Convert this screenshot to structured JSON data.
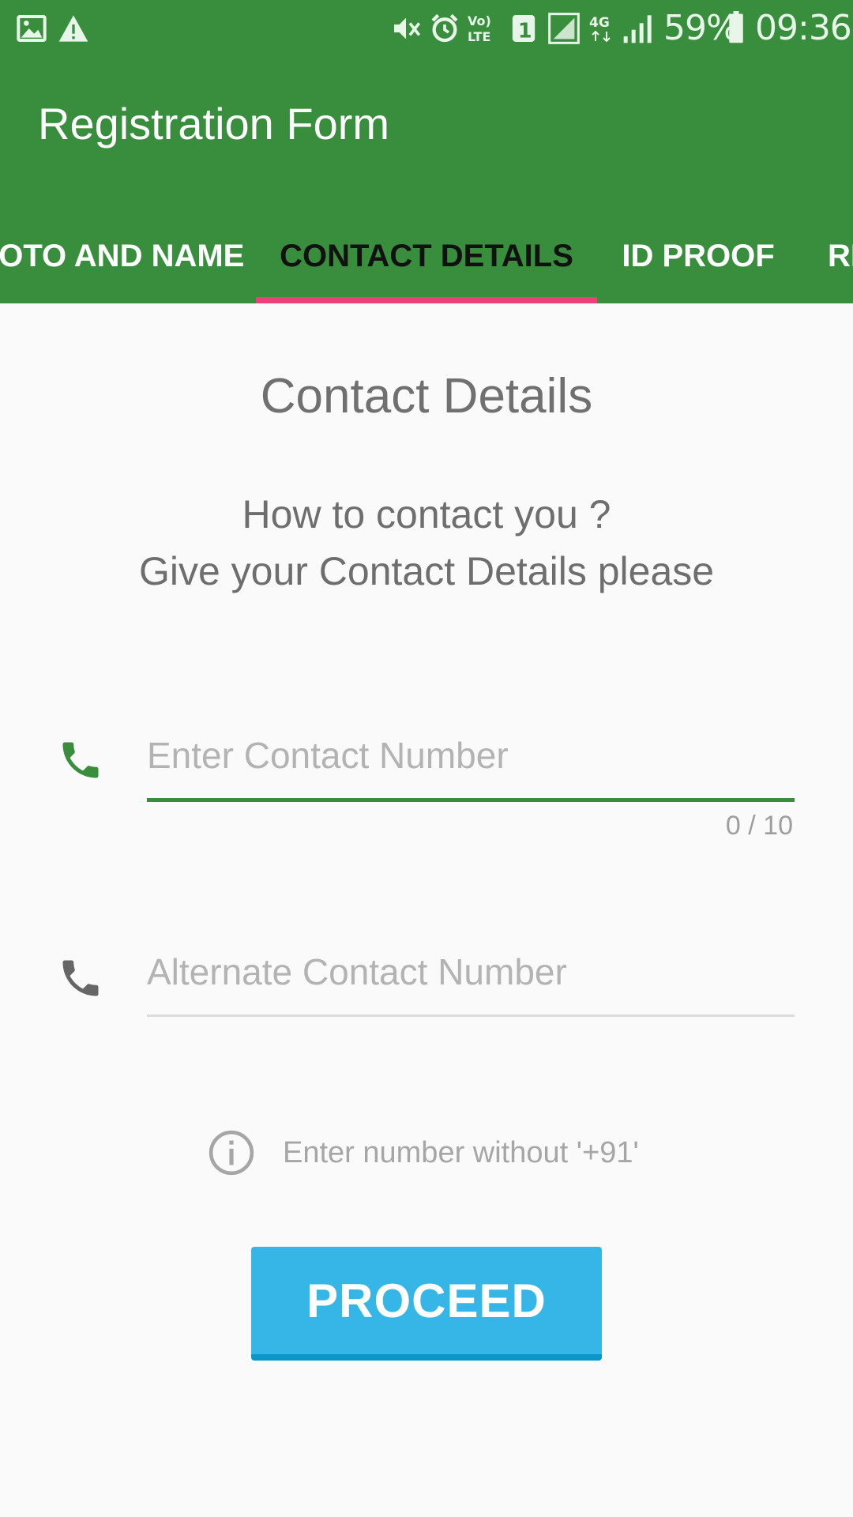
{
  "status_bar": {
    "icons": [
      "image-icon",
      "warning-icon",
      "mute-icon",
      "alarm-icon",
      "volte-icon",
      "sim1-icon",
      "signal-icon",
      "4g-icon",
      "signal-icon"
    ],
    "battery": "59%",
    "time": "09:36"
  },
  "app_bar": {
    "title": "Registration Form",
    "tabs": [
      {
        "label": "PHOTO AND NAME",
        "active": false
      },
      {
        "label": "CONTACT DETAILS",
        "active": true
      },
      {
        "label": "ID PROOF",
        "active": false
      },
      {
        "label": "RE",
        "active": false
      }
    ]
  },
  "content": {
    "heading": "Contact Details",
    "subtitle_line1": "How to contact you ?",
    "subtitle_line2": "Give your Contact Details please",
    "contact_field": {
      "placeholder": "Enter Contact Number",
      "value": "",
      "counter": "0 / 10"
    },
    "alternate_field": {
      "placeholder": "Alternate Contact Number",
      "value": ""
    },
    "hint": "Enter number without '+91'",
    "proceed_label": "PROCEED"
  },
  "colors": {
    "primary": "#388e3c",
    "tab_indicator": "#ec407a",
    "button": "#35b6e6",
    "active_icon": "#388e3c",
    "inactive_icon": "#666666"
  }
}
